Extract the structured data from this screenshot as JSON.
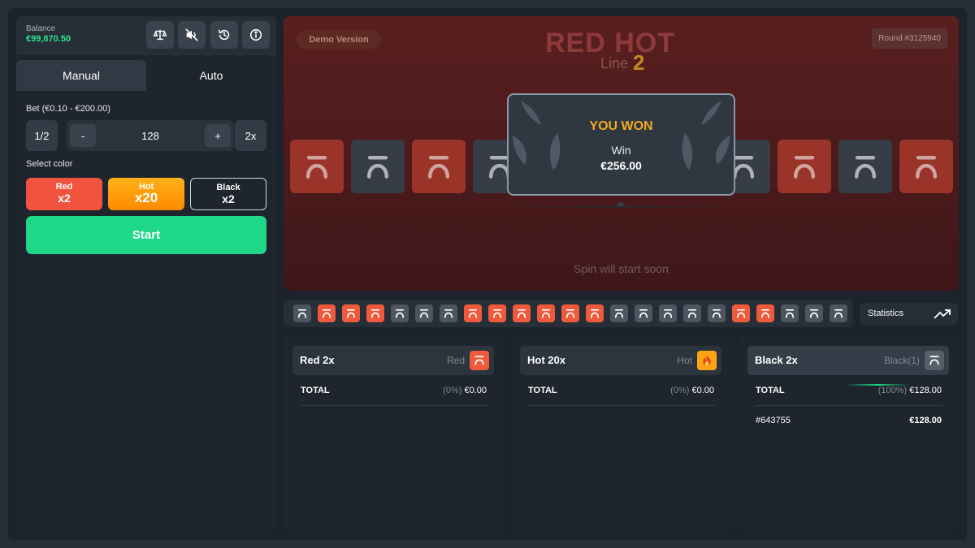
{
  "balance": {
    "label": "Balance",
    "value": "€99,870.50"
  },
  "toolbar_icons": [
    "scales-icon",
    "mute-icon",
    "history-icon",
    "info-icon"
  ],
  "tabs": [
    {
      "label": "Manual"
    },
    {
      "label": "Auto"
    }
  ],
  "bet": {
    "label": "Bet (€0.10 - €200.00)",
    "half": "1/2",
    "minus": "-",
    "value": "128",
    "plus": "+",
    "double": "2x"
  },
  "select_color": {
    "label": "Select color",
    "options": [
      {
        "name": "Red",
        "mult": "x2"
      },
      {
        "name": "Hot",
        "mult": "x20"
      },
      {
        "name": "Black",
        "mult": "x2"
      }
    ]
  },
  "start_label": "Start",
  "game": {
    "demo": "Demo Version",
    "round": "Round #3125940",
    "logo_top": "RED HOT",
    "logo_line": "Line",
    "logo_num": "2",
    "tiles": [
      "r",
      "b",
      "r",
      "b",
      "b",
      "r",
      "b",
      "r"
    ],
    "win": {
      "title": "YOU WON",
      "label": "Win",
      "amount": "€256.00"
    },
    "spin_text": "Spin will start soon"
  },
  "history": [
    "b",
    "r",
    "r",
    "r",
    "b",
    "b",
    "b",
    "r",
    "r",
    "r",
    "r",
    "r",
    "r",
    "b",
    "b",
    "b",
    "b",
    "b",
    "r",
    "r",
    "b",
    "b",
    "b"
  ],
  "statistics_label": "Statistics",
  "columns": [
    {
      "title": "Red 2x",
      "sub": "Red",
      "chip": "r",
      "total_label": "TOTAL",
      "pct": "(0%)",
      "amount": "€0.00",
      "rows": []
    },
    {
      "title": "Hot 20x",
      "sub": "Hot",
      "chip": "h",
      "total_label": "TOTAL",
      "pct": "(0%)",
      "amount": "€0.00",
      "rows": []
    },
    {
      "title": "Black 2x",
      "sub": "Black(1)",
      "chip": "b",
      "total_label": "TOTAL",
      "pct": "(100%)",
      "amount": "€128.00",
      "rows": [
        {
          "id": "#643755",
          "amount": "€128.00"
        }
      ]
    }
  ],
  "colors": {
    "red": "#f2533f",
    "hot": "#ff9a0a",
    "green": "#1ed787",
    "win_title": "#f2a81c"
  }
}
